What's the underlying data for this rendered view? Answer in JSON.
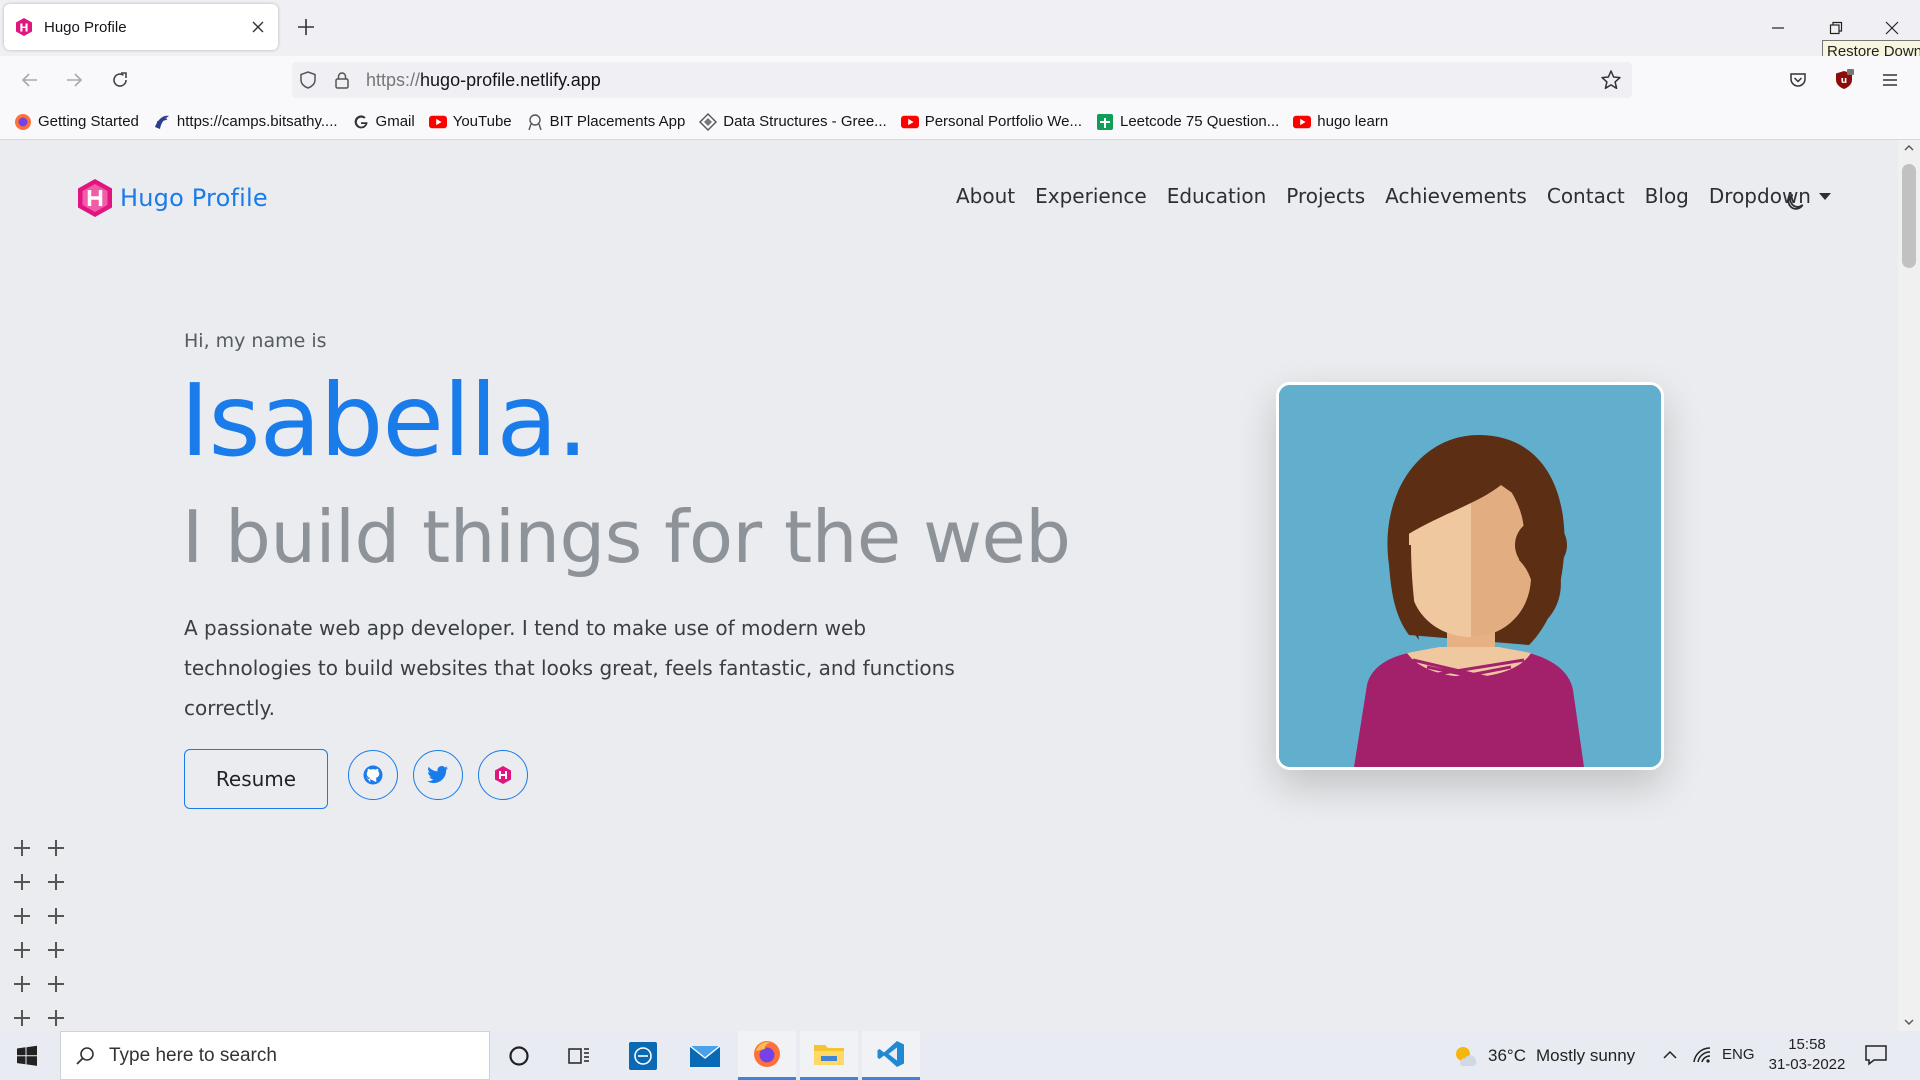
{
  "browser": {
    "tab": {
      "title": "Hugo Profile"
    },
    "tooltip": "Restore Down",
    "url": {
      "scheme": "https://",
      "host": "hugo-profile.netlify.app"
    },
    "bookmarks": [
      {
        "label": "Getting Started",
        "icon": "firefox-icon"
      },
      {
        "label": "https://camps.bitsathy....",
        "icon": "camps-icon"
      },
      {
        "label": "Gmail",
        "icon": "google-icon"
      },
      {
        "label": "YouTube",
        "icon": "youtube-icon"
      },
      {
        "label": "BIT Placements App",
        "icon": "bit-icon"
      },
      {
        "label": "Data Structures - Gree...",
        "icon": "gfg-icon"
      },
      {
        "label": "Personal Portfolio We...",
        "icon": "youtube-icon"
      },
      {
        "label": "Leetcode 75 Question...",
        "icon": "sheets-icon"
      },
      {
        "label": "hugo learn",
        "icon": "youtube-icon"
      }
    ]
  },
  "site": {
    "brand": "Hugo Profile",
    "nav": [
      {
        "label": "About"
      },
      {
        "label": "Experience"
      },
      {
        "label": "Education"
      },
      {
        "label": "Projects"
      },
      {
        "label": "Achievements"
      },
      {
        "label": "Contact"
      },
      {
        "label": "Blog"
      },
      {
        "label": "Dropdown"
      }
    ],
    "hero": {
      "greeting": "Hi, my name is",
      "name": "Isabella.",
      "tagline": "I build things for the web",
      "description": "A passionate web app developer. I tend to make use of modern web technologies to build websites that looks great, feels fantastic, and functions correctly.",
      "resume_label": "Resume",
      "socials": [
        {
          "name": "github-icon"
        },
        {
          "name": "twitter-icon"
        },
        {
          "name": "hugo-icon"
        }
      ]
    },
    "colors": {
      "accent": "#1a7bea",
      "avatar_bg": "#62aecd",
      "page_bg": "#eaecef"
    }
  },
  "taskbar": {
    "search_placeholder": "Type here to search",
    "weather": {
      "temp": "36°C",
      "condition": "Mostly sunny"
    },
    "language": "ENG",
    "time": "15:58",
    "date": "31-03-2022"
  }
}
